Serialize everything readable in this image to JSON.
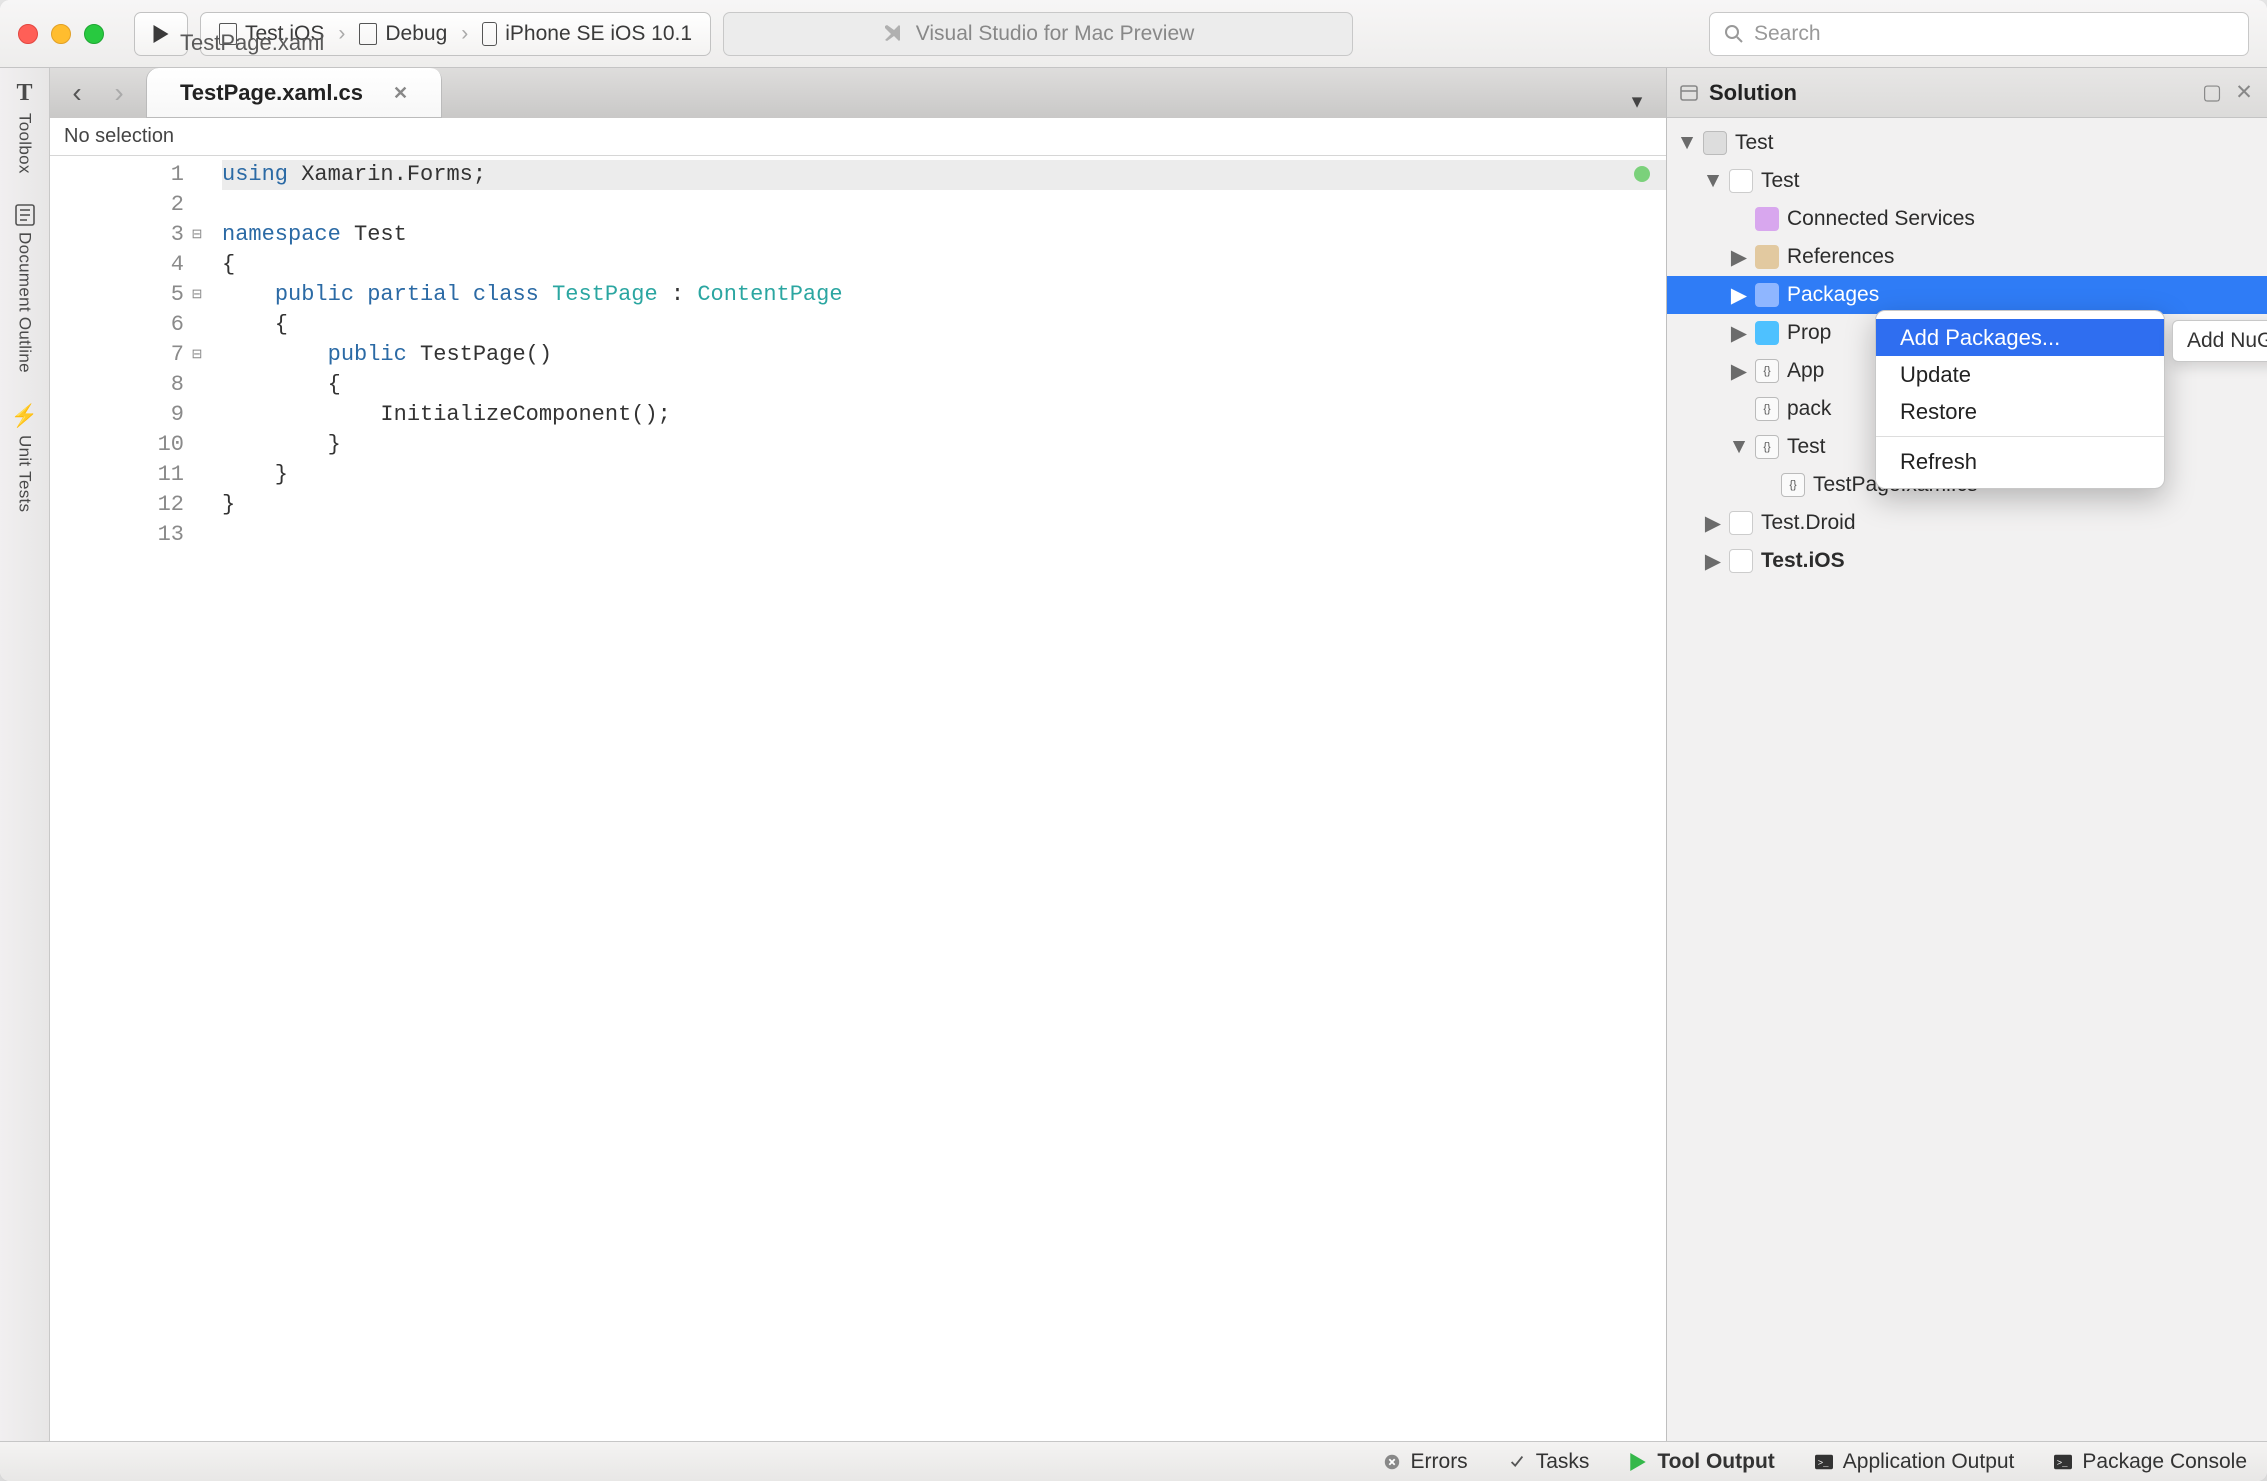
{
  "toolbar": {
    "config": {
      "project": "Test.iOS",
      "build": "Debug",
      "device": "iPhone SE iOS 10.1"
    },
    "title": "Visual Studio for Mac Preview",
    "search_placeholder": "Search"
  },
  "leftstrip": {
    "toolbox": "Toolbox",
    "outline": "Document Outline",
    "tests": "Unit Tests"
  },
  "tabs": [
    {
      "label": "TestPage.xaml",
      "active": false
    },
    {
      "label": "TestPage.xaml.cs",
      "active": true
    }
  ],
  "crumb": "No selection",
  "code": {
    "lines": [
      {
        "n": 1,
        "seg": [
          [
            "k",
            "using"
          ],
          [
            "p",
            " Xamarin.Forms;"
          ]
        ],
        "hl": true
      },
      {
        "n": 2,
        "seg": []
      },
      {
        "n": 3,
        "seg": [
          [
            "k",
            "namespace"
          ],
          [
            "p",
            " Test"
          ]
        ],
        "fold": true
      },
      {
        "n": 4,
        "seg": [
          [
            "p",
            "{"
          ]
        ]
      },
      {
        "n": 5,
        "seg": [
          [
            "p",
            "    "
          ],
          [
            "k",
            "public"
          ],
          [
            "p",
            " "
          ],
          [
            "k",
            "partial"
          ],
          [
            "p",
            " "
          ],
          [
            "k",
            "class"
          ],
          [
            "p",
            " "
          ],
          [
            "t",
            "TestPage"
          ],
          [
            "p",
            " : "
          ],
          [
            "t",
            "ContentPage"
          ]
        ],
        "fold": true
      },
      {
        "n": 6,
        "seg": [
          [
            "p",
            "    {"
          ]
        ]
      },
      {
        "n": 7,
        "seg": [
          [
            "p",
            "        "
          ],
          [
            "k",
            "public"
          ],
          [
            "p",
            " TestPage()"
          ]
        ],
        "fold": true
      },
      {
        "n": 8,
        "seg": [
          [
            "p",
            "        {"
          ]
        ]
      },
      {
        "n": 9,
        "seg": [
          [
            "p",
            "            InitializeComponent();"
          ]
        ]
      },
      {
        "n": 10,
        "seg": [
          [
            "p",
            "        }"
          ]
        ]
      },
      {
        "n": 11,
        "seg": [
          [
            "p",
            "    }"
          ]
        ]
      },
      {
        "n": 12,
        "seg": [
          [
            "p",
            "}"
          ]
        ]
      },
      {
        "n": 13,
        "seg": []
      }
    ]
  },
  "solution": {
    "title": "Solution",
    "tree": [
      {
        "d": 0,
        "exp": "open",
        "kind": "sol",
        "label": "Test"
      },
      {
        "d": 1,
        "exp": "open",
        "kind": "proj",
        "label": "Test"
      },
      {
        "d": 2,
        "exp": "",
        "kind": "serv",
        "label": "Connected Services"
      },
      {
        "d": 2,
        "exp": "closed",
        "kind": "ref",
        "label": "References"
      },
      {
        "d": 2,
        "exp": "closed",
        "kind": "pkg",
        "label": "Packages",
        "sel": true
      },
      {
        "d": 2,
        "exp": "closed",
        "kind": "prop",
        "label": "Prop"
      },
      {
        "d": 2,
        "exp": "closed",
        "kind": "cs",
        "label": "App"
      },
      {
        "d": 2,
        "exp": "",
        "kind": "cs",
        "label": "pack"
      },
      {
        "d": 2,
        "exp": "open",
        "kind": "cs",
        "label": "Test"
      },
      {
        "d": 3,
        "exp": "",
        "kind": "cs",
        "label": "TestPage.xaml.cs"
      },
      {
        "d": 1,
        "exp": "closed",
        "kind": "proj",
        "label": "Test.Droid"
      },
      {
        "d": 1,
        "exp": "closed",
        "kind": "proj",
        "label": "Test.iOS",
        "bold": true
      }
    ]
  },
  "context_menu": {
    "items": [
      "Add Packages...",
      "Update",
      "Restore",
      "Refresh"
    ],
    "highlight": 0,
    "tooltip": "Add NuGe"
  },
  "status": {
    "errors": "Errors",
    "tasks": "Tasks",
    "tool": "Tool Output",
    "app": "Application Output",
    "pkg": "Package Console"
  }
}
